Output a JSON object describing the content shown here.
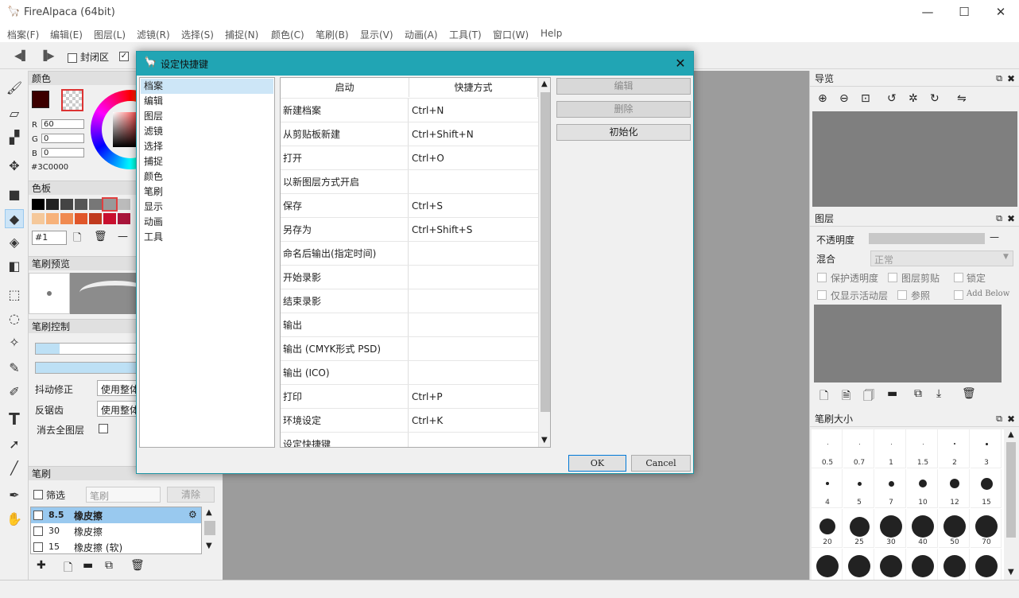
{
  "app": {
    "title": "FireAlpaca (64bit)"
  },
  "window_controls": {
    "minimize": "—",
    "maximize": "☐",
    "close": "✕"
  },
  "menu": [
    "档案(F)",
    "编辑(E)",
    "图层(L)",
    "滤镜(R)",
    "选择(S)",
    "捕捉(N)",
    "颜色(C)",
    "笔刷(B)",
    "显示(V)",
    "动画(A)",
    "工具(T)",
    "窗口(W)",
    "Help"
  ],
  "toolbar": {
    "closed_area_label": "封闭区",
    "closed_area_checked": false
  },
  "color_panel": {
    "title": "颜色",
    "r_label": "R",
    "g_label": "G",
    "b_label": "B",
    "r": "60",
    "g": "0",
    "b": "0",
    "hex": "#3C0000",
    "fg_color": "#3c0000"
  },
  "palette_panel": {
    "title": "色板",
    "selector": "#1",
    "colors": [
      "#000000",
      "#222222",
      "#444444",
      "#555555",
      "#777777",
      "#999999",
      "#bbbbbb",
      "#f5c89a",
      "#f7b27a",
      "#f08a50",
      "#e0562a",
      "#c03a1e",
      "#c8102e",
      "#a8143a"
    ]
  },
  "brush_preview_panel": {
    "title": "笔刷预览"
  },
  "brush_control_panel": {
    "title": "笔刷控制",
    "stabilizer_label": "抖动修正",
    "stabilizer_value": "使用整体",
    "antialias_label": "反锯齿",
    "antialias_value": "使用整体",
    "erase_all_label": "消去全图层"
  },
  "brush_panel": {
    "title": "笔刷",
    "filter_label": "筛选",
    "filter_placeholder": "笔刷",
    "clear_label": "清除",
    "items": [
      {
        "size": "8.5",
        "name": "橡皮擦",
        "selected": true
      },
      {
        "size": "30",
        "name": "橡皮擦",
        "selected": false
      },
      {
        "size": "15",
        "name": "橡皮擦 (软)",
        "selected": false
      }
    ]
  },
  "navigator_panel": {
    "title": "导览"
  },
  "layer_panel": {
    "title": "图层",
    "opacity_label": "不透明度",
    "blend_label": "混合",
    "blend_value": "正常",
    "options": [
      "保护透明度",
      "图层剪贴",
      "锁定",
      "仅显示活动层",
      "参照",
      "Add Below"
    ]
  },
  "brush_size_panel": {
    "title": "笔刷大小",
    "sizes": [
      {
        "label": "0.5",
        "d": 1
      },
      {
        "label": "0.7",
        "d": 1
      },
      {
        "label": "1",
        "d": 1
      },
      {
        "label": "1.5",
        "d": 1
      },
      {
        "label": "2",
        "d": 2
      },
      {
        "label": "3",
        "d": 3
      },
      {
        "label": "4",
        "d": 4
      },
      {
        "label": "5",
        "d": 5
      },
      {
        "label": "7",
        "d": 7
      },
      {
        "label": "10",
        "d": 10
      },
      {
        "label": "12",
        "d": 12
      },
      {
        "label": "15",
        "d": 15
      },
      {
        "label": "20",
        "d": 20
      },
      {
        "label": "25",
        "d": 25
      },
      {
        "label": "30",
        "d": 28
      },
      {
        "label": "40",
        "d": 28
      },
      {
        "label": "50",
        "d": 28
      },
      {
        "label": "70",
        "d": 28
      },
      {
        "label": "",
        "d": 28
      },
      {
        "label": "",
        "d": 28
      },
      {
        "label": "",
        "d": 28
      },
      {
        "label": "",
        "d": 28
      },
      {
        "label": "",
        "d": 28
      },
      {
        "label": "",
        "d": 28
      }
    ]
  },
  "dialog": {
    "title": "设定快捷键",
    "categories": [
      "档案",
      "编辑",
      "图层",
      "滤镜",
      "选择",
      "捕捉",
      "颜色",
      "笔刷",
      "显示",
      "动画",
      "工具"
    ],
    "col_action": "启动",
    "col_shortcut": "快捷方式",
    "rows": [
      {
        "action": "新建档案",
        "shortcut": "Ctrl+N"
      },
      {
        "action": "从剪贴板新建",
        "shortcut": "Ctrl+Shift+N"
      },
      {
        "action": "打开",
        "shortcut": "Ctrl+O"
      },
      {
        "action": "以新图层方式开启",
        "shortcut": ""
      },
      {
        "action": "保存",
        "shortcut": "Ctrl+S"
      },
      {
        "action": "另存为",
        "shortcut": "Ctrl+Shift+S"
      },
      {
        "action": "命名后输出(指定时间)",
        "shortcut": ""
      },
      {
        "action": "开始录影",
        "shortcut": ""
      },
      {
        "action": "结束录影",
        "shortcut": ""
      },
      {
        "action": "输出",
        "shortcut": ""
      },
      {
        "action": "输出 (CMYK形式 PSD)",
        "shortcut": ""
      },
      {
        "action": "输出 (ICO)",
        "shortcut": ""
      },
      {
        "action": "打印",
        "shortcut": "Ctrl+P"
      },
      {
        "action": "环境设定",
        "shortcut": "Ctrl+K"
      },
      {
        "action": "设定快捷键",
        "shortcut": ""
      }
    ],
    "edit_label": "编辑",
    "delete_label": "删除",
    "init_label": "初始化",
    "ok_label": "OK",
    "cancel_label": "Cancel"
  }
}
